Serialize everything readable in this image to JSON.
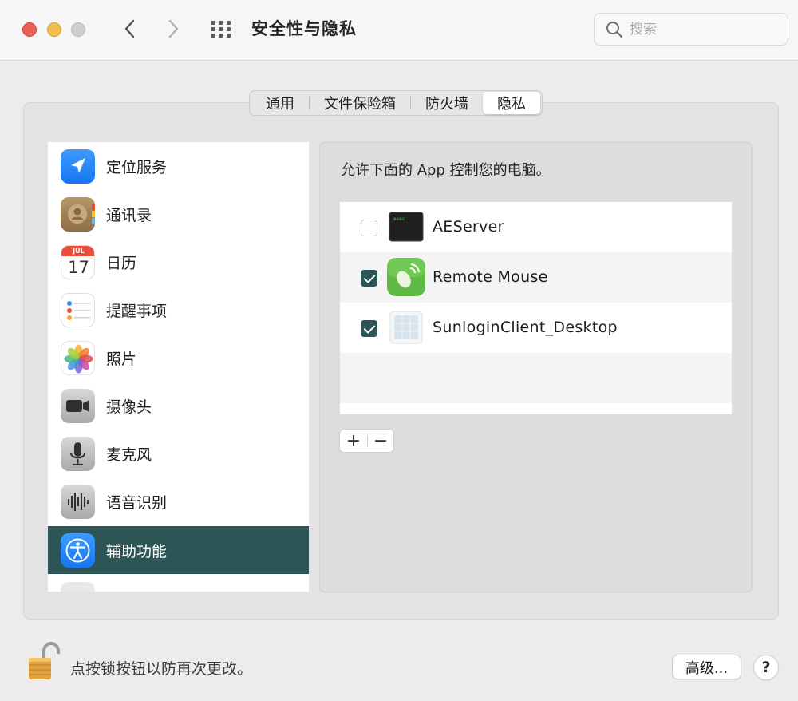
{
  "window": {
    "title": "安全性与隐私",
    "search_placeholder": "搜索"
  },
  "tabs": [
    {
      "label": "通用",
      "active": false
    },
    {
      "label": "文件保险箱",
      "active": false
    },
    {
      "label": "防火墙",
      "active": false
    },
    {
      "label": "隐私",
      "active": true
    }
  ],
  "sidebar": {
    "items": [
      {
        "label": "定位服务",
        "icon": "location-services-icon"
      },
      {
        "label": "通讯录",
        "icon": "contacts-icon"
      },
      {
        "label": "日历",
        "icon": "calendar-icon"
      },
      {
        "label": "提醒事项",
        "icon": "reminders-icon"
      },
      {
        "label": "照片",
        "icon": "photos-icon"
      },
      {
        "label": "摄像头",
        "icon": "camera-icon"
      },
      {
        "label": "麦克风",
        "icon": "microphone-icon"
      },
      {
        "label": "语音识别",
        "icon": "speech-recognition-icon"
      },
      {
        "label": "辅助功能",
        "icon": "accessibility-icon",
        "selected": true
      }
    ],
    "calendar_month": "JUL",
    "calendar_day": "17"
  },
  "main": {
    "header": "允许下面的 App 控制您的电脑。",
    "apps": [
      {
        "name": "AEServer",
        "checked": false,
        "icon": "exec-terminal-icon",
        "icon_text": "exec"
      },
      {
        "name": "Remote Mouse",
        "checked": true,
        "icon": "remote-mouse-icon"
      },
      {
        "name": "SunloginClient_Desktop",
        "checked": true,
        "icon": "sunlogin-icon"
      }
    ],
    "add_label": "+",
    "remove_label": "−"
  },
  "footer": {
    "lock_text": "点按锁按钮以防再次更改。",
    "advanced_label": "高级...",
    "help_label": "?"
  },
  "colors": {
    "selection": "#2e5555",
    "checkbox_checked": "#2e5555",
    "close": "#ec5f56",
    "minimize": "#f3be4f",
    "zoom_disabled": "#cfcfcf"
  }
}
